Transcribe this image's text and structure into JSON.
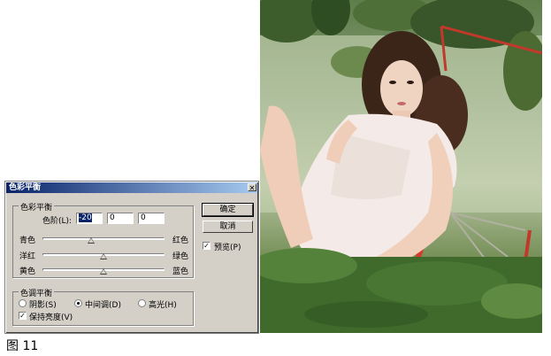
{
  "dialog": {
    "title": "色彩平衡",
    "close_glyph": "✕",
    "color_balance_group": {
      "label": "色彩平衡",
      "levels_label": "色阶(L):",
      "levels": [
        "-20",
        "0",
        "0"
      ],
      "sliders": [
        {
          "left": "青色",
          "right": "红色",
          "value": -20
        },
        {
          "left": "洋红",
          "right": "绿色",
          "value": 0
        },
        {
          "left": "黄色",
          "right": "蓝色",
          "value": 0
        }
      ]
    },
    "tone_group": {
      "label": "色调平衡",
      "options": [
        "阴影(S)",
        "中间调(D)",
        "高光(H)"
      ],
      "selected": "中间调(D)",
      "preserve_luminosity": "保持亮度(V)",
      "preserve_checked": true
    },
    "buttons": {
      "ok": "确定",
      "cancel": "取消"
    },
    "preview": {
      "label": "预览(P)",
      "checked": true
    }
  },
  "caption": "图 11",
  "colors": {
    "title_start": "#0a246a",
    "title_end": "#a6caf0",
    "dialog_bg": "#d4d0c8"
  }
}
